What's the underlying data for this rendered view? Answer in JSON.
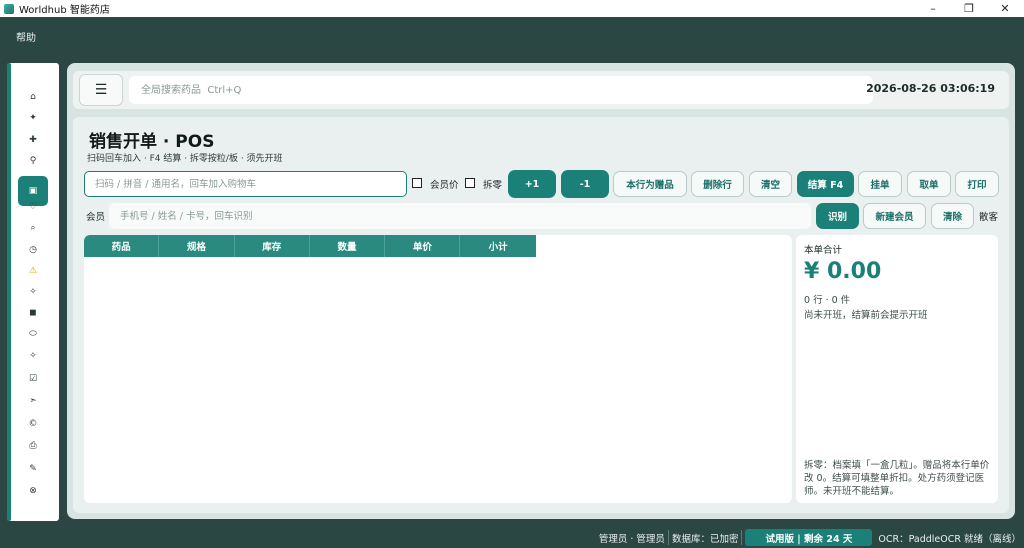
{
  "window": {
    "title": "Worldhub 智能药店",
    "minimize_icon": "–",
    "restore_icon": "❐",
    "close_icon": "✕"
  },
  "menu": {
    "items": [
      "帮助"
    ]
  },
  "sidebar": {
    "items": [
      {
        "icon": "home-icon",
        "glyph": "⌂"
      },
      {
        "icon": "sparkle-icon",
        "glyph": "✦"
      },
      {
        "icon": "plus-icon",
        "glyph": "✚"
      },
      {
        "icon": "user-icon",
        "glyph": "⚲"
      },
      {
        "icon": "cart-icon",
        "glyph": "▣",
        "active": true
      },
      {
        "icon": "heart-icon",
        "glyph": "♡"
      },
      {
        "icon": "search-icon",
        "glyph": "⌕"
      },
      {
        "icon": "clock-icon",
        "glyph": "◷"
      },
      {
        "icon": "warning-icon",
        "glyph": "⚠"
      },
      {
        "icon": "star-icon",
        "glyph": "✧"
      },
      {
        "icon": "box-icon",
        "glyph": "◼"
      },
      {
        "icon": "pill-icon",
        "glyph": "⬭"
      },
      {
        "icon": "settings-icon",
        "glyph": "✧"
      },
      {
        "icon": "edit-icon",
        "glyph": "☑"
      },
      {
        "icon": "send-icon",
        "glyph": "➣"
      },
      {
        "icon": "copyright-icon",
        "glyph": "©"
      },
      {
        "icon": "printer-icon",
        "glyph": "⎙"
      },
      {
        "icon": "pen-icon",
        "glyph": "✎"
      },
      {
        "icon": "logout-icon",
        "glyph": "⊗"
      }
    ]
  },
  "topbar": {
    "menu_icon": "☰",
    "search_placeholder": "全局搜索药品  Ctrl+Q",
    "datetime": "2026-08-26  03:06:19"
  },
  "page": {
    "title": "销售开单 · POS",
    "subtitle": "扫码回车加入 · F4 结算 · 拆零按粒/板 · 须先开班"
  },
  "toolbar": {
    "scan_placeholder": "扫码 / 拼音 / 通用名，回车加入购物车",
    "member_price_label": "会员价",
    "split_label": "拆零",
    "buttons": {
      "plus_one": "+1",
      "minus_one": "-1",
      "gift": "本行为赠品",
      "delete_row": "删除行",
      "clear": "清空",
      "checkout": "结算 F4",
      "hold": "挂单",
      "retrieve": "取单",
      "print": "打印"
    }
  },
  "member": {
    "label": "会员",
    "placeholder": "手机号 / 姓名 / 卡号，回车识别",
    "identify": "识别",
    "new_member": "新建会员",
    "clear": "清除",
    "walk_in": "散客"
  },
  "cart": {
    "columns": [
      "药品",
      "规格",
      "库存",
      "数量",
      "单价",
      "小计"
    ],
    "rows": []
  },
  "summary": {
    "title": "本单合计",
    "total": "¥ 0.00",
    "count": "0 行 · 0 件",
    "note": "尚未开班，结算前会提示开班",
    "help": "拆零：档案填「一盒几粒」。赠品将本行单价改 0。结算可填整单折扣。处方药须登记医师。未开班不能结算。"
  },
  "status": {
    "operator": "管理员 · 管理员",
    "database": "数据库：已加密",
    "trial": "试用版 | 剩余 24 天",
    "ocr": "OCR：PaddleOCR 就绪（离线）"
  },
  "colors": {
    "primary": "#1b8078",
    "chrome": "#2b4744",
    "panel": "#eaf0ef"
  }
}
